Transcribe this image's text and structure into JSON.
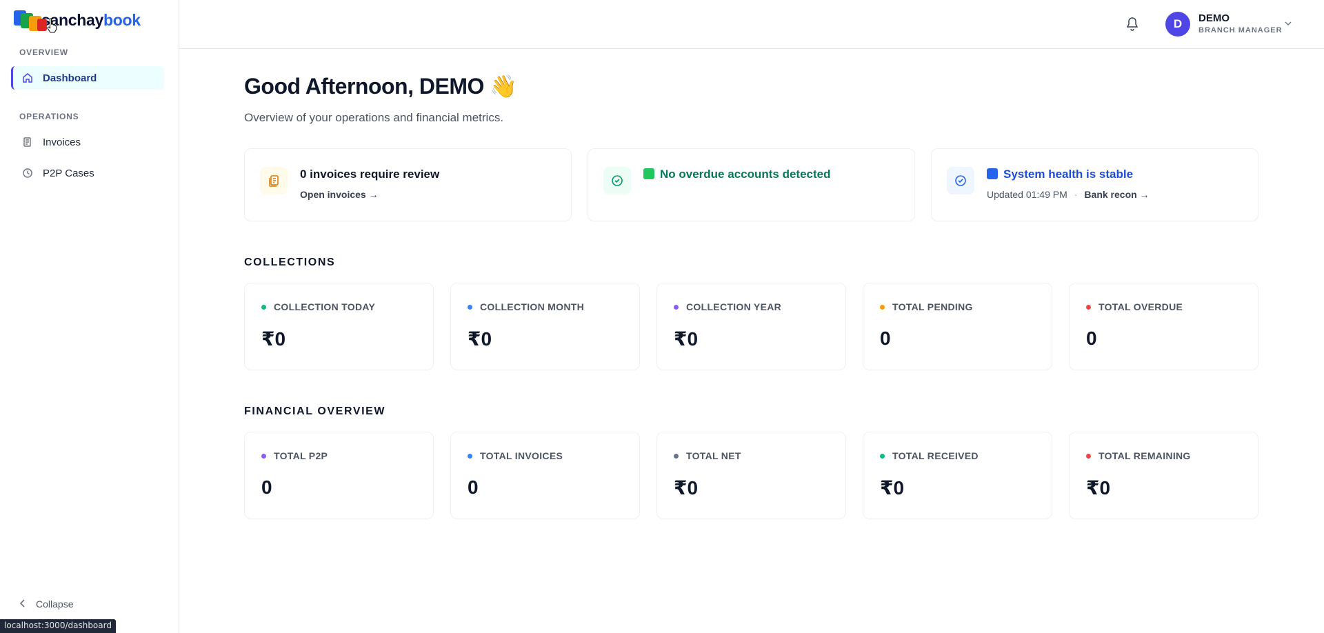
{
  "brand": {
    "name_part1": "sanchay",
    "name_part2": "book"
  },
  "sidebar": {
    "sections": [
      {
        "label": "OVERVIEW"
      },
      {
        "label": "OPERATIONS"
      }
    ],
    "items": [
      {
        "label": "Dashboard",
        "icon": "home-icon",
        "active": true
      },
      {
        "label": "Invoices",
        "icon": "invoice-icon"
      },
      {
        "label": "P2P Cases",
        "icon": "clock-icon"
      }
    ],
    "collapse_label": "Collapse"
  },
  "status_bar": {
    "url": "localhost:3000/dashboard"
  },
  "header": {
    "user": {
      "initial": "D",
      "name": "DEMO",
      "role": "BRANCH MANAGER"
    }
  },
  "main": {
    "greeting": "Good Afternoon, DEMO 👋",
    "subtitle": "Overview of your operations and financial metrics.",
    "alerts": [
      {
        "title": "0 invoices require review",
        "link": "Open invoices →",
        "icon": "document-stack-icon",
        "color": "#0f172a"
      },
      {
        "title": "No overdue accounts detected",
        "icon": "check-circle-icon",
        "color": "#047857"
      },
      {
        "title": "System health is stable",
        "updated": "Updated 01:49 PM",
        "link": "Bank recon →",
        "icon": "check-circle-icon",
        "color": "#1d4ed8"
      }
    ],
    "collections": {
      "title": "COLLECTIONS",
      "cards": [
        {
          "label": "COLLECTION TODAY",
          "value": "₹0",
          "color": "#10b981"
        },
        {
          "label": "COLLECTION MONTH",
          "value": "₹0",
          "color": "#3b82f6"
        },
        {
          "label": "COLLECTION YEAR",
          "value": "₹0",
          "color": "#8b5cf6"
        },
        {
          "label": "TOTAL PENDING",
          "value": "0",
          "color": "#f59e0b"
        },
        {
          "label": "TOTAL OVERDUE",
          "value": "0",
          "color": "#ef4444"
        }
      ]
    },
    "financial": {
      "title": "FINANCIAL OVERVIEW",
      "cards": [
        {
          "label": "TOTAL P2P",
          "value": "0",
          "color": "#8b5cf6"
        },
        {
          "label": "TOTAL INVOICES",
          "value": "0",
          "color": "#3b82f6"
        },
        {
          "label": "TOTAL NET",
          "value": "₹0",
          "color": "#64748b"
        },
        {
          "label": "TOTAL RECEIVED",
          "value": "₹0",
          "color": "#10b981"
        },
        {
          "label": "TOTAL REMAINING",
          "value": "₹0",
          "color": "#ef4444"
        }
      ]
    }
  }
}
